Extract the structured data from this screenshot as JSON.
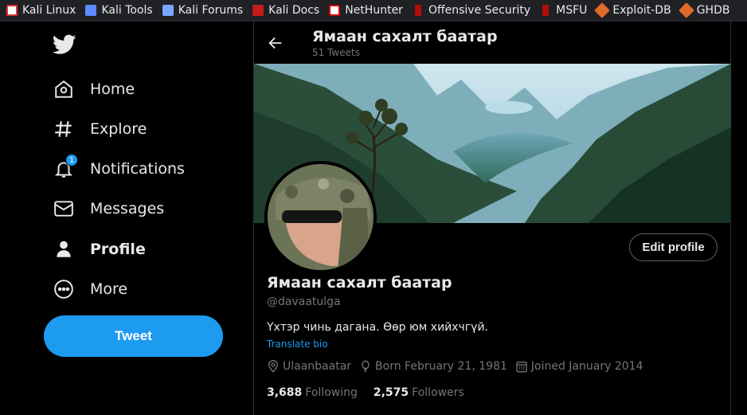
{
  "bookmarks": [
    {
      "label": "Kali Linux",
      "icon": "kali-linux-icon"
    },
    {
      "label": "Kali Tools",
      "icon": "kali-tools-icon"
    },
    {
      "label": "Kali Forums",
      "icon": "kali-forums-icon"
    },
    {
      "label": "Kali Docs",
      "icon": "kali-docs-icon"
    },
    {
      "label": "NetHunter",
      "icon": "nethunter-icon"
    },
    {
      "label": "Offensive Security",
      "icon": "offensive-security-icon"
    },
    {
      "label": "MSFU",
      "icon": "msfu-icon"
    },
    {
      "label": "Exploit-DB",
      "icon": "exploit-db-icon"
    },
    {
      "label": "GHDB",
      "icon": "ghdb-icon"
    }
  ],
  "nav": {
    "items": [
      {
        "label": "Home",
        "icon": "home-icon"
      },
      {
        "label": "Explore",
        "icon": "hashtag-icon"
      },
      {
        "label": "Notifications",
        "icon": "bell-icon",
        "badge": "1"
      },
      {
        "label": "Messages",
        "icon": "envelope-icon"
      },
      {
        "label": "Profile",
        "icon": "person-icon",
        "active": true
      },
      {
        "label": "More",
        "icon": "more-circle-icon"
      }
    ],
    "tweet_label": "Tweet"
  },
  "header": {
    "title": "Ямаан сахалт баатар",
    "tweet_count": "51 Tweets"
  },
  "profile": {
    "edit_label": "Edit profile",
    "name": "Ямаан сахалт баатар",
    "handle": "@davaatulga",
    "bio": "Үхтэр чинь дагана. Өөр юм хийхчгүй.",
    "translate_label": "Translate bio",
    "location": "Ulaanbaatar",
    "born": "Born February 21, 1981",
    "joined": "Joined January 2014",
    "following_count": "3,688",
    "following_label": "Following",
    "followers_count": "2,575",
    "followers_label": "Followers"
  },
  "colors": {
    "accent": "#1d9bf0",
    "background": "#000000",
    "muted_text": "#71767b"
  }
}
